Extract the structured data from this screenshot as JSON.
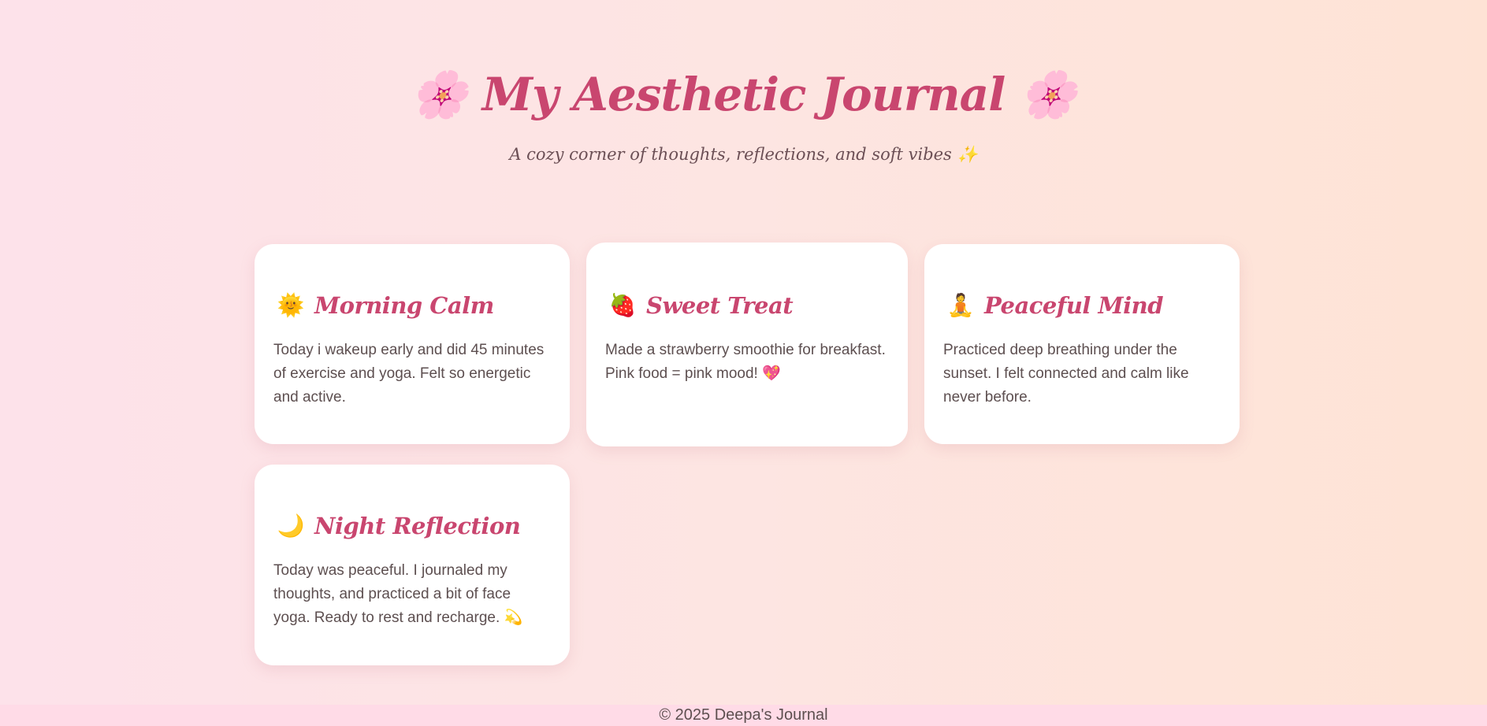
{
  "header": {
    "title": "🌸 My Aesthetic Journal 🌸",
    "subtitle": "A cozy corner of thoughts, reflections, and soft vibes ✨"
  },
  "entries": [
    {
      "emoji": "🌞",
      "emoji_name": "smiling-sun-icon",
      "title": "Morning Calm",
      "text": "Today i wakeup early and did 45 minutes of exercise and yoga. Felt so energetic and active."
    },
    {
      "emoji": "🍓",
      "emoji_name": "strawberry-icon",
      "title": "Sweet Treat",
      "text": "Made a strawberry smoothie for breakfast. Pink food = pink mood! 💖"
    },
    {
      "emoji": "🧘",
      "emoji_name": "meditation-icon",
      "title": "Peaceful Mind",
      "text": "Practiced deep breathing under the sunset. I felt connected and calm like never before."
    },
    {
      "emoji": "🌙",
      "emoji_name": "crescent-moon-icon",
      "title": "Night Reflection",
      "text": "Today was peaceful. I journaled my thoughts, and practiced a bit of face yoga. Ready to rest and recharge. 💫"
    }
  ],
  "footer": {
    "text": "© 2025 Deepa's Journal"
  },
  "colors": {
    "accent": "#c9466f",
    "text": "#5d4f50",
    "footer_bg": "#ffdbe7",
    "card_bg": "#ffffff"
  }
}
